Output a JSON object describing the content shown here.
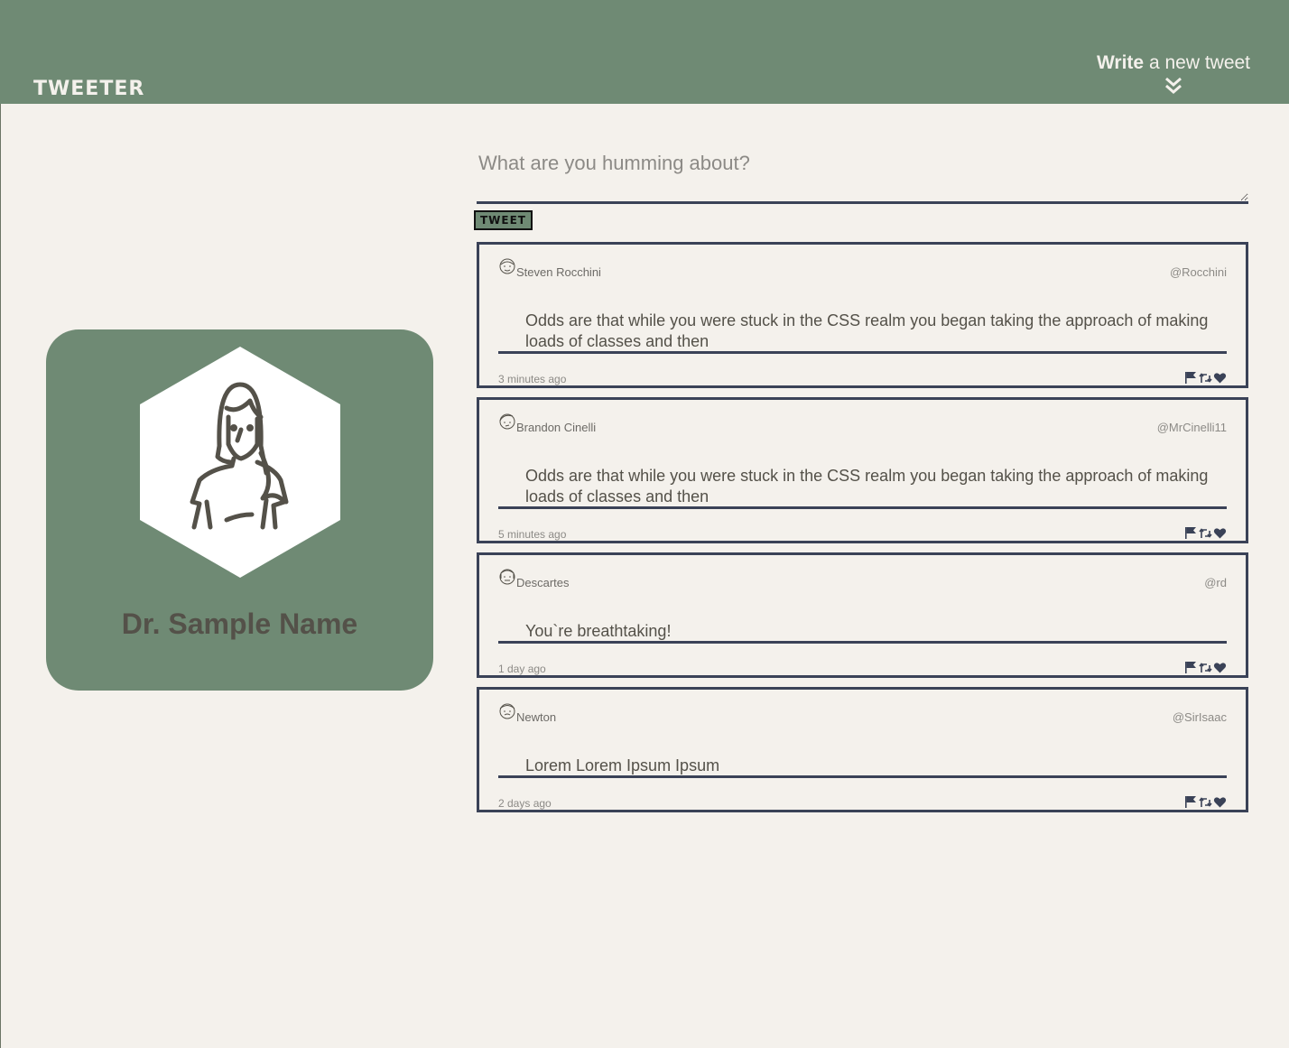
{
  "nav": {
    "brand": "TWEETER",
    "compose_bold": "Write",
    "compose_rest": " a new tweet",
    "compose_icon": "double-chevron-down-icon"
  },
  "profile": {
    "name": "Dr. Sample Name",
    "avatar_icon": "woman-avatar-icon"
  },
  "composer": {
    "placeholder": "What are you humming about?",
    "value": "",
    "button_label": "TWEET"
  },
  "tweets": [
    {
      "name": "Steven Rocchini",
      "handle": "@Rocchini",
      "text": "Odds are that while you were stuck in the CSS realm you began taking the approach of making loads of classes and then",
      "time": "3 minutes ago"
    },
    {
      "name": "Brandon Cinelli",
      "handle": "@MrCinelli11",
      "text": "Odds are that while you were stuck in the CSS realm you began taking the approach of making loads of classes and then",
      "time": "5 minutes ago"
    },
    {
      "name": "Descartes",
      "handle": "@rd",
      "text": "You`re breathtaking!",
      "time": "1 day ago"
    },
    {
      "name": "Newton",
      "handle": "@SirIsaac",
      "text": "Lorem Lorem Ipsum Ipsum",
      "time": "2 days ago"
    }
  ],
  "icons": {
    "flag": "flag-icon",
    "retweet": "retweet-icon",
    "like": "heart-icon"
  },
  "colors": {
    "accent": "#6f8a74",
    "background": "#f4f1ec",
    "border": "#3a4257",
    "text": "#545149"
  }
}
